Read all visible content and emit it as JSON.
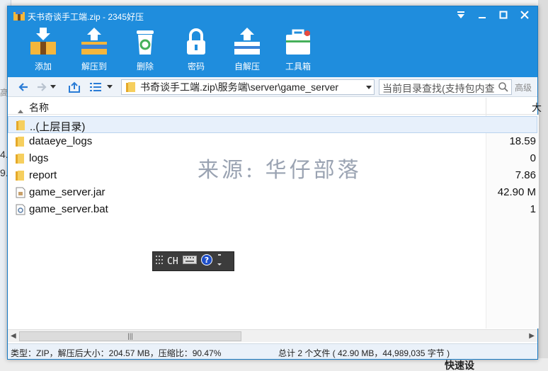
{
  "window": {
    "title": "天书奇谈手工端.zip - 2345好压"
  },
  "toolbar": {
    "items": [
      {
        "label": "添加",
        "icon": "add-icon"
      },
      {
        "label": "解压到",
        "icon": "extract-to-icon"
      },
      {
        "label": "删除",
        "icon": "delete-icon"
      },
      {
        "label": "密码",
        "icon": "lock-icon"
      },
      {
        "label": "自解压",
        "icon": "self-extract-icon"
      },
      {
        "label": "工具箱",
        "icon": "toolbox-icon"
      }
    ]
  },
  "address": {
    "path": "书奇谈手工端.zip\\服务端\\server\\game_server",
    "search_placeholder": "当前目录查找(支持包内查",
    "advanced_label": "高级"
  },
  "columns": {
    "name": "名称",
    "size": "大"
  },
  "files": [
    {
      "name": "..(上层目录)",
      "size": "",
      "type": "folder",
      "selected": true
    },
    {
      "name": "dataeye_logs",
      "size": "18.59",
      "type": "folder"
    },
    {
      "name": "logs",
      "size": "0",
      "type": "folder"
    },
    {
      "name": "report",
      "size": "7.86",
      "type": "folder"
    },
    {
      "name": "game_server.jar",
      "size": "42.90 M",
      "type": "jar"
    },
    {
      "name": "game_server.bat",
      "size": "1",
      "type": "bat"
    }
  ],
  "watermark": "来源: 华仔部落",
  "ime": {
    "lang": "CH"
  },
  "status": {
    "left": "类型：ZIP，解压后大小：204.57 MB，压缩比：90.47%",
    "right": "总计 2 个文件 ( 42.90 MB，44,989,035 字节 )"
  },
  "background": {
    "left_fragments": [
      "高",
      "4.",
      "9."
    ],
    "bottom_text": "快速设"
  },
  "colors": {
    "titlebar": "#1f8ddd",
    "folder": "#f2c14a",
    "selected_row": "#e7f0fb"
  }
}
